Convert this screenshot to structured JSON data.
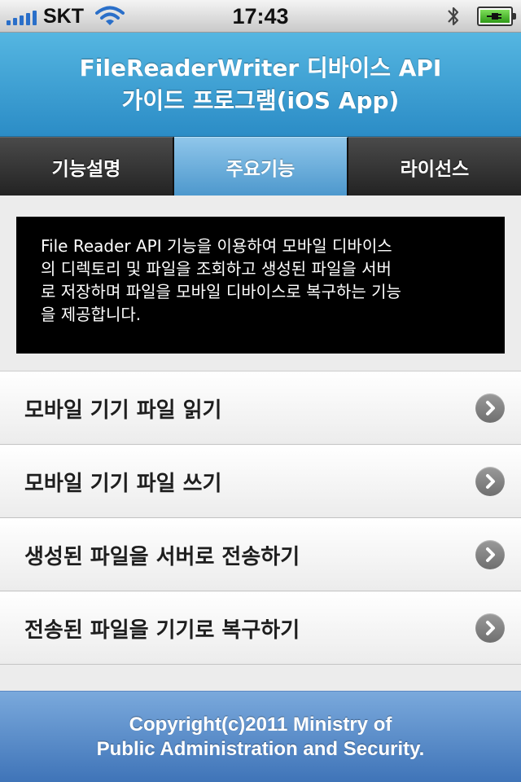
{
  "status_bar": {
    "carrier": "SKT",
    "time": "17:43",
    "icons": [
      "signal-bars-icon",
      "wifi-icon",
      "bluetooth-icon",
      "battery-charging-icon"
    ]
  },
  "header": {
    "title_line1": "FileReaderWriter 디바이스 API",
    "title_line2": "가이드 프로그램(iOS App)"
  },
  "tabs": [
    {
      "label": "기능설명",
      "active": false
    },
    {
      "label": "주요기능",
      "active": true
    },
    {
      "label": "라이선스",
      "active": false
    }
  ],
  "description": {
    "lines": [
      "File Reader API 기능을 이용하여 모바일 디바이스",
      "의 디렉토리 및 파일을 조회하고 생성된 파일을 서버",
      "로 저장하며 파일을 모바일 디바이스로 복구하는 기능",
      "을 제공합니다."
    ]
  },
  "menu": [
    {
      "label": "모바일 기기 파일 읽기",
      "icon": "chevron-right-circle-icon"
    },
    {
      "label": "모바일 기기 파일 쓰기",
      "icon": "chevron-right-circle-icon"
    },
    {
      "label": "생성된 파일을 서버로 전송하기",
      "icon": "chevron-right-circle-icon"
    },
    {
      "label": "전송된 파일을 기기로 복구하기",
      "icon": "chevron-right-circle-icon"
    }
  ],
  "footer": {
    "line1": "Copyright(c)2011 Ministry of",
    "line2": "Public Administration and Security."
  },
  "colors": {
    "header_blue": "#3fa3d6",
    "active_tab_blue": "#6fb0dc",
    "footer_blue": "#5a8ccb",
    "chevron_gray": "#888888"
  }
}
